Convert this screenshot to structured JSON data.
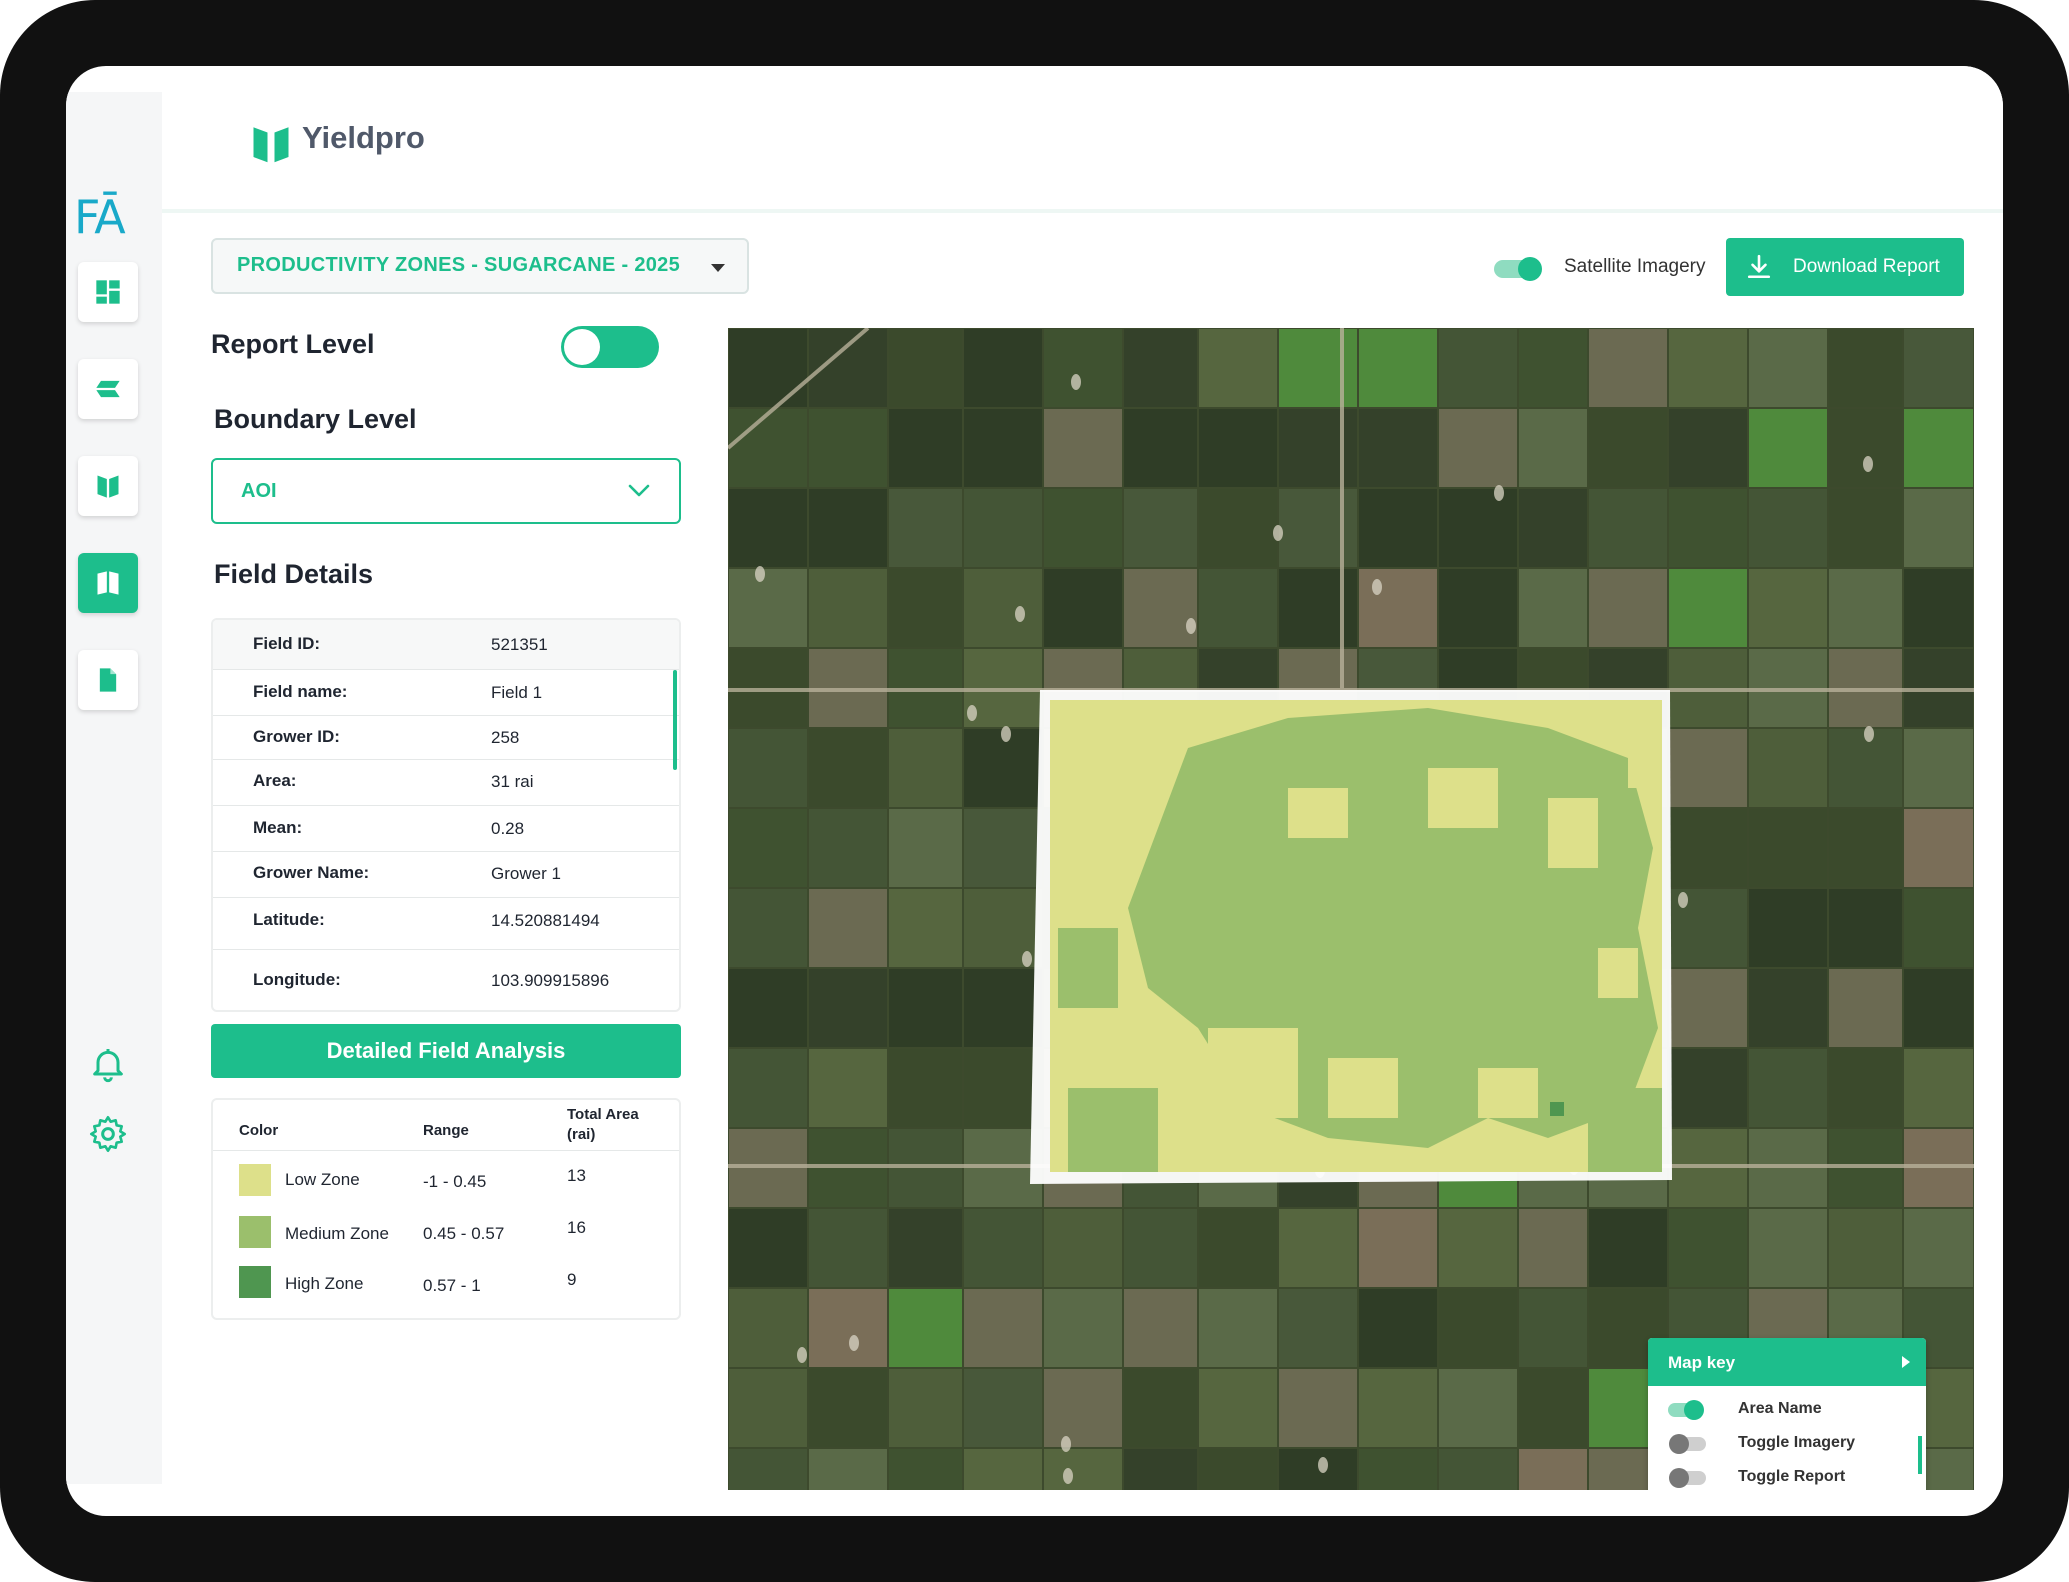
{
  "app": {
    "brand": "Yieldpro",
    "logo_text": "FĀ"
  },
  "toolbar": {
    "report_select": "PRODUCTIVITY ZONES - SUGARCANE - 2025",
    "satellite_label": "Satellite Imagery",
    "satellite_on": true,
    "download_label": "Download Report"
  },
  "panel": {
    "report_level_label": "Report Level",
    "report_level_on": true,
    "boundary_level_label": "Boundary Level",
    "boundary_value": "AOI",
    "field_details_label": "Field Details",
    "details": [
      {
        "key": "Field ID:",
        "value": "521351"
      },
      {
        "key": "Field name:",
        "value": "Field 1"
      },
      {
        "key": "Grower ID:",
        "value": "258"
      },
      {
        "key": "Area:",
        "value": "31 rai"
      },
      {
        "key": "Mean:",
        "value": "0.28"
      },
      {
        "key": "Grower Name:",
        "value": "Grower 1"
      },
      {
        "key": "Latitude:",
        "value": "14.520881494"
      },
      {
        "key": "Longitude:",
        "value": "103.909915896"
      }
    ],
    "analysis_button": "Detailed Field Analysis"
  },
  "legend": {
    "headers": {
      "color": "Color",
      "range": "Range",
      "area_line1": "Total Area",
      "area_line2": "(rai)"
    },
    "rows": [
      {
        "zone": "Low Zone",
        "range": "-1 - 0.45",
        "area": "13",
        "color": "#dde08a"
      },
      {
        "zone": "Medium Zone",
        "range": "0.45 - 0.57",
        "area": "16",
        "color": "#9bbf6c"
      },
      {
        "zone": "High Zone",
        "range": "0.57 - 1",
        "area": "9",
        "color": "#4f9650"
      }
    ]
  },
  "mapkey": {
    "title": "Map key",
    "items": [
      {
        "label": "Area Name",
        "on": true
      },
      {
        "label": "Toggle Imagery",
        "on": false
      },
      {
        "label": "Toggle Report",
        "on": false
      }
    ]
  },
  "colors": {
    "accent": "#1dbe8c",
    "low": "#dde08a",
    "medium": "#9bbf6c",
    "high": "#4f9650"
  }
}
